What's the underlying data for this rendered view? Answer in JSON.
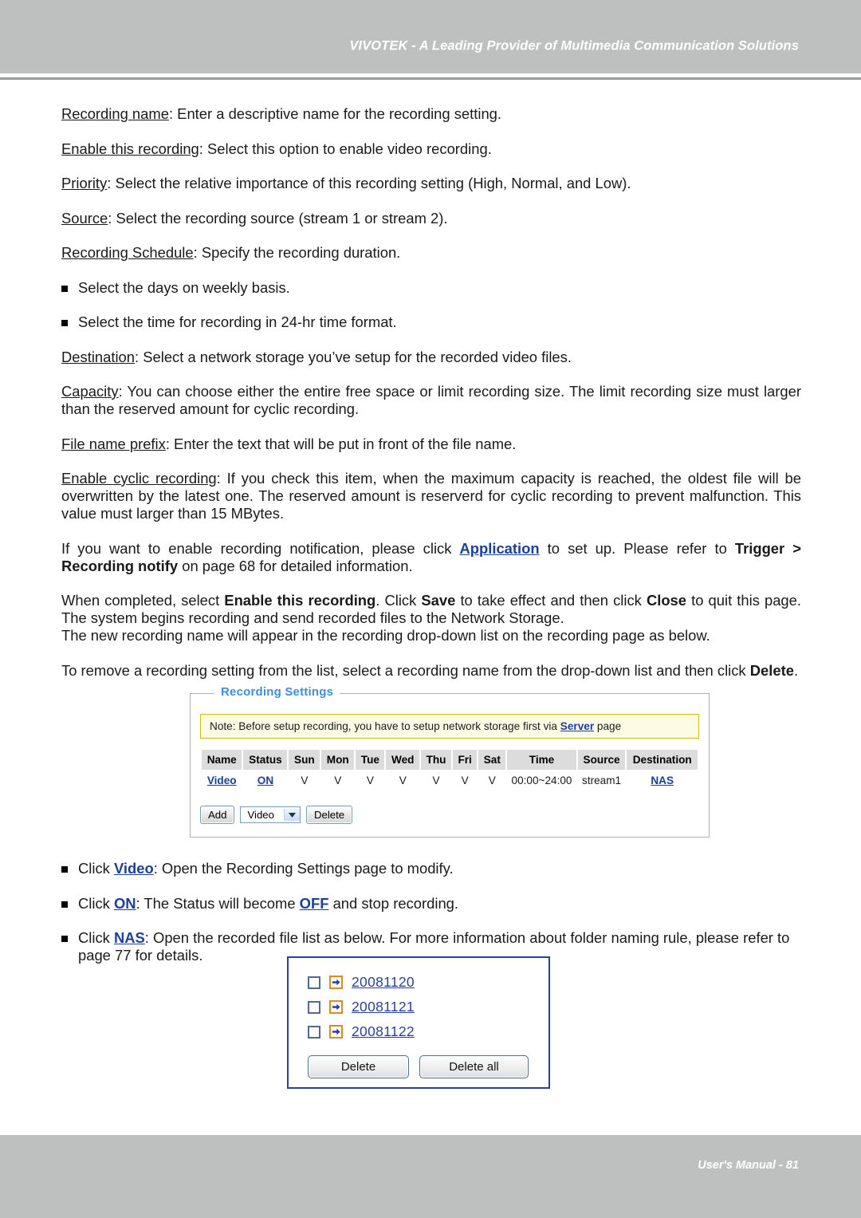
{
  "header": {
    "title": "VIVOTEK - A Leading Provider of Multimedia Communication Solutions"
  },
  "footer": {
    "text": "User's Manual - 81"
  },
  "body": {
    "definitions": [
      {
        "term": "Recording name",
        "desc": ": Enter a descriptive name for the recording setting."
      },
      {
        "term": "Enable this recording",
        "desc": ": Select this option to enable video recording."
      },
      {
        "term": "Priority",
        "desc": ": Select the relative importance of this recording setting (High, Normal, and Low)."
      },
      {
        "term": "Source",
        "desc": ": Select the recording source (stream 1 or stream 2)."
      },
      {
        "term": "Recording Schedule",
        "desc": ": Specify the recording duration."
      }
    ],
    "schedule_bullets": [
      "Select the days on weekly basis.",
      "Select the time for recording in 24-hr time format."
    ],
    "definitions2": [
      {
        "term": "Destination",
        "desc": ": Select a network storage you’ve setup for the recorded video files."
      },
      {
        "term": "Capacity",
        "desc": ": You can choose either the entire free space or limit recording size. The limit recording size must larger than the reserved amount for cyclic recording."
      },
      {
        "term": "File name prefix",
        "desc": ": Enter the text that will be put in front of the file name."
      },
      {
        "term": "Enable cyclic recording",
        "desc": ": If you check this item, when the maximum capacity is reached, the oldest file will be overwritten by the latest one. The reserved amount is reserverd for cyclic recording to prevent malfunction. This value must larger than 15 MBytes."
      }
    ],
    "para_application": {
      "pre": "If you want to enable recording notification, please click ",
      "link": "Application",
      "mid": " to set up. Please refer to ",
      "bold1": "Trigger > Recording notify",
      "post": " on page 68 for detailed information."
    },
    "para_complete": {
      "pre": "When completed, select ",
      "bold1": "Enable this recording",
      "mid1": ". Click ",
      "bold2": "Save",
      "mid2": " to take effect and then click ",
      "bold3": "Close",
      "post": " to quit this page. The system begins recording and send recorded files to the Network Storage."
    },
    "para_newname": "The new recording name will appear in the recording drop-down list on the recording page as below.",
    "para_remove": {
      "pre": "To remove a recording setting from the list, select a recording name from the drop-down list and then click ",
      "bold1": "Delete",
      "post": "."
    },
    "click_bullets": [
      {
        "pre": "Click ",
        "link": "Video",
        "post": ": Open the Recording Settings page to modify."
      },
      {
        "pre": "Click ",
        "link": "ON",
        "mid": ": The Status will become ",
        "link2": "OFF",
        "post": " and stop recording."
      },
      {
        "pre": "Click ",
        "link": "NAS",
        "post": ": Open the recorded file list as below. For more information about folder naming rule, please refer to page 77 for details."
      }
    ]
  },
  "recording_settings": {
    "legend": "Recording Settings",
    "note": {
      "pre": "Note: Before setup recording, you have to setup network storage first via ",
      "link": "Server",
      "post": " page"
    },
    "columns": [
      "Name",
      "Status",
      "Sun",
      "Mon",
      "Tue",
      "Wed",
      "Thu",
      "Fri",
      "Sat",
      "Time",
      "Source",
      "Destination"
    ],
    "rows": [
      {
        "name": "Video",
        "status": "ON",
        "sun": "V",
        "mon": "V",
        "tue": "V",
        "wed": "V",
        "thu": "V",
        "fri": "V",
        "sat": "V",
        "time": "00:00~24:00",
        "source": "stream1",
        "destination": "NAS"
      }
    ],
    "controls": {
      "add_label": "Add",
      "select_value": "Video",
      "delete_label": "Delete"
    }
  },
  "file_list": {
    "items": [
      {
        "label": "20081120"
      },
      {
        "label": "20081121"
      },
      {
        "label": "20081122"
      }
    ],
    "delete_label": "Delete",
    "delete_all_label": "Delete all"
  },
  "colors": {
    "header_band": "#bec0c0",
    "link_blue": "#1a3f9e",
    "legend_blue": "#3f8ede",
    "note_bg": "#fdfbe4",
    "note_border": "#d6b800",
    "table_header_bg": "#dcdcdc",
    "file_box_border": "#2a3f9e",
    "arrow_icon_border": "#e08a1e"
  }
}
